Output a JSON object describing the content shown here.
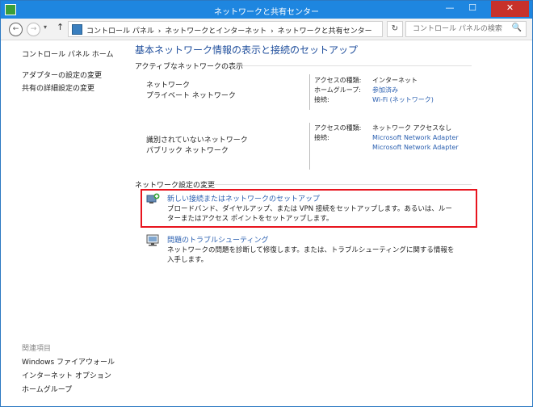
{
  "window": {
    "title": "ネットワークと共有センター",
    "min": "—",
    "max": "☐",
    "close": "✕"
  },
  "nav": {
    "back": "←",
    "forward": "→",
    "recent": "▾",
    "up": "↑",
    "refresh": "↻",
    "dropdown": "▾"
  },
  "breadcrumbs": [
    "コントロール パネル",
    "›",
    "ネットワークとインターネット",
    "›",
    "ネットワークと共有センター"
  ],
  "search": {
    "placeholder": "コントロール パネルの検索",
    "icon": "🔍"
  },
  "sidebar": {
    "home": "コントロール パネル ホーム",
    "adapter": "アダプターの設定の変更",
    "sharing": "共有の詳細設定の変更",
    "related_title": "関連項目",
    "related": [
      "Windows ファイアウォール",
      "インターネット オプション",
      "ホームグループ"
    ]
  },
  "main": {
    "heading": "基本ネットワーク情報の表示と接続のセットアップ",
    "active_title": "アクティブなネットワークの表示",
    "net1": {
      "name": "ネットワーク",
      "type": "プライベート ネットワーク",
      "k1": "アクセスの種類:",
      "v1": "インターネット",
      "k2": "ホームグループ:",
      "v2": "参加済み",
      "k3": "接続:",
      "v3": "Wi-Fi (ネットワーク)"
    },
    "net2": {
      "name": "識別されていないネットワーク",
      "type": "パブリック ネットワーク",
      "k1": "アクセスの種類:",
      "v1": "ネットワーク アクセスなし",
      "k2": "接続:",
      "v2a": "Microsoft Network Adapter",
      "v2b": "Microsoft Network Adapter"
    },
    "change_title": "ネットワーク設定の変更",
    "task1": {
      "title": "新しい接続またはネットワークのセットアップ",
      "desc": "ブロードバンド、ダイヤルアップ、または VPN 接続をセットアップします。あるいは、ルーターまたはアクセス ポイントをセットアップします。"
    },
    "task2": {
      "title": "問題のトラブルシューティング",
      "desc": "ネットワークの問題を診断して修復します。または、トラブルシューティングに関する情報を入手します。"
    }
  }
}
